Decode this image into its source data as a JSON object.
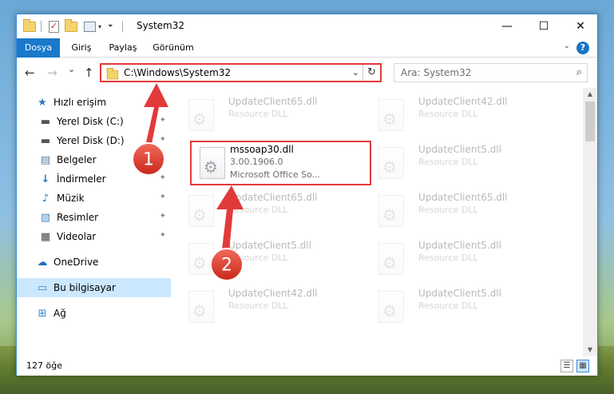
{
  "window": {
    "title": "System32",
    "minimize_glyph": "—",
    "maximize_glyph": "☐",
    "close_glyph": "✕"
  },
  "ribbon": {
    "tabs": [
      "Dosya",
      "Giriş",
      "Paylaş",
      "Görünüm"
    ],
    "help_glyph": "?",
    "caret_glyph": "⌄"
  },
  "nav": {
    "back_glyph": "←",
    "forward_glyph": "→",
    "recent_glyph": "⌄",
    "up_glyph": "↑",
    "address": "C:\\Windows\\System32",
    "dropdown_glyph": "⌄",
    "refresh_glyph": "↻",
    "search_placeholder": "Ara: System32",
    "search_glyph": "⌕"
  },
  "sidebar": {
    "items": [
      {
        "label": "Hızlı erişim",
        "icon": "star-icon",
        "glyph": "★",
        "color": "#2f78c4"
      },
      {
        "label": "Yerel Disk (C:)",
        "icon": "drive-icon",
        "glyph": "▬",
        "color": "#555555",
        "pinned": true
      },
      {
        "label": "Yerel Disk (D:)",
        "icon": "drive-icon",
        "glyph": "▬",
        "color": "#555555",
        "pinned": true
      },
      {
        "label": "Belgeler",
        "icon": "documents-icon",
        "glyph": "▤",
        "color": "#5a7fa8",
        "pinned": true
      },
      {
        "label": "İndirmeler",
        "icon": "download-icon",
        "glyph": "↓",
        "color": "#2f78c4",
        "pinned": true
      },
      {
        "label": "Müzik",
        "icon": "music-icon",
        "glyph": "♪",
        "color": "#2f78c4",
        "pinned": true
      },
      {
        "label": "Resimler",
        "icon": "pictures-icon",
        "glyph": "▧",
        "color": "#4a8ac4",
        "pinned": true
      },
      {
        "label": "Videolar",
        "icon": "videos-icon",
        "glyph": "▦",
        "color": "#444444",
        "pinned": true
      },
      {
        "label": "OneDrive",
        "icon": "cloud-icon",
        "glyph": "☁",
        "color": "#1e6fc0"
      },
      {
        "label": "Bu bilgisayar",
        "icon": "computer-icon",
        "glyph": "▭",
        "color": "#3a86c8",
        "selected": true
      },
      {
        "label": "Ağ",
        "icon": "network-icon",
        "glyph": "⊞",
        "color": "#3a86c8"
      }
    ],
    "pin_glyph": "📌"
  },
  "files": [
    {
      "name": "UpdateClient65.dll",
      "line2": "Resource DLL",
      "line3": ""
    },
    {
      "name": "UpdateClient42.dll",
      "line2": "Resource DLL",
      "line3": ""
    },
    {
      "name": "mssoap30.dll",
      "line2": "3.00.1906.0",
      "line3": "Microsoft Office So..."
    },
    {
      "name": "UpdateClient5.dll",
      "line2": "Resource DLL",
      "line3": ""
    },
    {
      "name": "UpdateClient65.dll",
      "line2": "Resource DLL",
      "line3": ""
    },
    {
      "name": "UpdateClient65.dll",
      "line2": "Resource DLL",
      "line3": ""
    },
    {
      "name": "UpdateClient5.dll",
      "line2": "Resource DLL",
      "line3": ""
    },
    {
      "name": "UpdateClient5.dll",
      "line2": "Resource DLL",
      "line3": ""
    },
    {
      "name": "UpdateClient42.dll",
      "line2": "Resource DLL",
      "line3": ""
    },
    {
      "name": "UpdateClient5.dll",
      "line2": "Resource DLL",
      "line3": ""
    }
  ],
  "status": {
    "count": "127 öğe",
    "details_glyph": "☰",
    "tiles_glyph": "▦"
  },
  "annotations": {
    "step1": "1",
    "step2": "2",
    "color": "#e23a3a"
  },
  "scroll": {
    "up_glyph": "▲",
    "down_glyph": "▼"
  }
}
